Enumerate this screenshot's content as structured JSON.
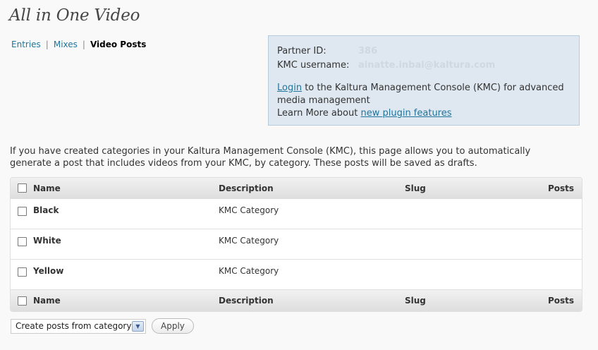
{
  "page": {
    "title": "All in One Video"
  },
  "subnav": {
    "entries": "Entries",
    "mixes": "Mixes",
    "video_posts": "Video Posts",
    "separator": "|"
  },
  "kmc": {
    "partner_label": "Partner ID:",
    "partner_value": "386",
    "username_label": "KMC username:",
    "username_value": "ainatte.inbal@kaltura.com",
    "login_link": "Login",
    "login_text": " to the Kaltura Management Console (KMC) for advanced media management",
    "learn_text": "Learn More about ",
    "learn_link": "new plugin features"
  },
  "intro": "If you have created categories in your Kaltura Management Console (KMC), this page allows you to automatically generate a post that includes videos from your KMC, by category. These posts will be saved as drafts.",
  "table": {
    "columns": {
      "name": "Name",
      "description": "Description",
      "slug": "Slug",
      "posts": "Posts"
    },
    "rows": [
      {
        "name": "Black",
        "description": "KMC Category",
        "slug": "",
        "posts": ""
      },
      {
        "name": "White",
        "description": "KMC Category",
        "slug": "",
        "posts": ""
      },
      {
        "name": "Yellow",
        "description": "KMC Category",
        "slug": "",
        "posts": ""
      }
    ]
  },
  "bulk": {
    "selected": "Create posts from category",
    "apply": "Apply"
  },
  "colors": {
    "link": "#21759b",
    "info_box_bg": "#dfe8f1"
  },
  "icons": {
    "dropdown": "chevron-down-icon",
    "checkbox": "checkbox-icon"
  }
}
